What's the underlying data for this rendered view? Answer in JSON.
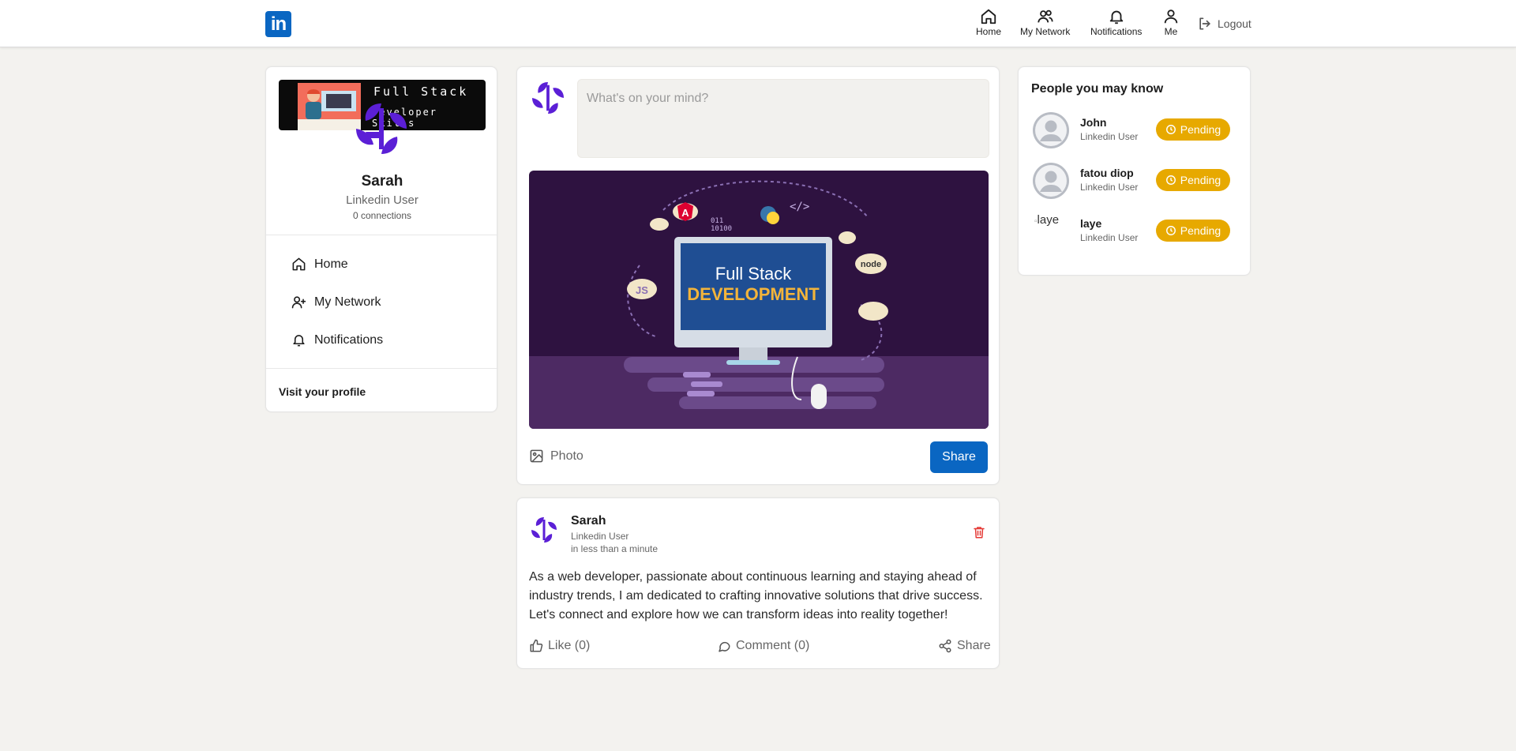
{
  "header": {
    "logo_text": "in",
    "nav": [
      {
        "label": "Home",
        "icon": "home-icon"
      },
      {
        "label": "My Network",
        "icon": "network-icon"
      },
      {
        "label": "Notifications",
        "icon": "bell-icon"
      },
      {
        "label": "Me",
        "icon": "user-icon"
      }
    ],
    "logout_label": "Logout"
  },
  "profile": {
    "banner_line1": "Full Stack",
    "banner_line2": "Developer Skills",
    "name": "Sarah",
    "title": "Linkedin User",
    "connections": "0 connections",
    "menu": [
      {
        "label": "Home",
        "icon": "home-icon"
      },
      {
        "label": "My Network",
        "icon": "add-user-icon"
      },
      {
        "label": "Notifications",
        "icon": "bell-icon"
      }
    ],
    "visit_label": "Visit your profile"
  },
  "composer": {
    "placeholder": "What's on your mind?",
    "image_title_line1": "Full Stack",
    "image_title_line2": "DEVELOPMENT",
    "photo_label": "Photo",
    "share_label": "Share"
  },
  "post": {
    "author": "Sarah",
    "author_title": "Linkedin User",
    "time": "in less than a minute",
    "text": "As a web developer, passionate about continuous learning and staying ahead of industry trends, I am dedicated to crafting innovative solutions that drive success. Let's connect and explore how we can transform ideas into reality together!",
    "like_label": "Like (0)",
    "comment_label": "Comment (0)",
    "share_label": "Share"
  },
  "suggestions": {
    "title": "People you may know",
    "people": [
      {
        "name": "John",
        "title": "Linkedin User",
        "status": "Pending"
      },
      {
        "name": "fatou diop",
        "title": "Linkedin User",
        "status": "Pending"
      },
      {
        "name": "laye",
        "title": "Linkedin User",
        "status": "Pending",
        "alt": "laye"
      }
    ]
  },
  "colors": {
    "brand": "#0a66c2",
    "pending": "#e7a900",
    "avatar_purple": "#5b1fd6"
  }
}
